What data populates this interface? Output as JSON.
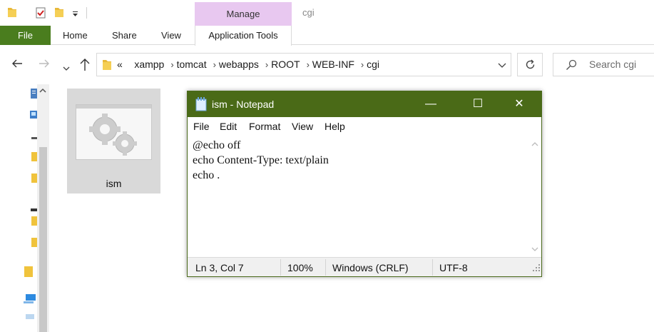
{
  "explorer": {
    "window_title": "cgi",
    "contextual_group": "Manage",
    "tabs": [
      "File",
      "Home",
      "Share",
      "View",
      "Application Tools"
    ],
    "breadcrumb_overflow": "«",
    "breadcrumbs": [
      "xampp",
      "tomcat",
      "webapps",
      "ROOT",
      "WEB-INF",
      "cgi"
    ],
    "search_placeholder": "Search cgi",
    "files": [
      {
        "name": "ism",
        "selected": true
      }
    ]
  },
  "notepad": {
    "title": "ism - Notepad",
    "menu": [
      "File",
      "Edit",
      "Format",
      "View",
      "Help"
    ],
    "lines": [
      "@echo off",
      "echo Content-Type: text/plain",
      "echo ."
    ],
    "status": {
      "position": "Ln 3, Col 7",
      "zoom": "100%",
      "line_endings": "Windows (CRLF)",
      "encoding": "UTF-8"
    },
    "controls": {
      "minimize": "—",
      "maximize": "☐",
      "close": "✕"
    }
  },
  "colors": {
    "file_tab": "#4a7d1e",
    "manage_tab": "#e8c8f0",
    "notepad_titlebar": "#4a6a17"
  }
}
